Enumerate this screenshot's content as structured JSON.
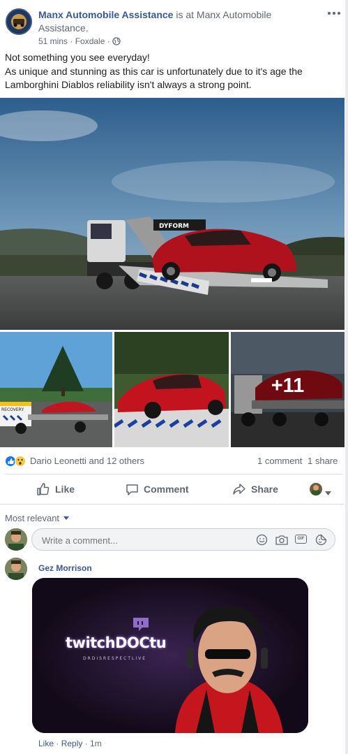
{
  "post": {
    "page_name": "Manx Automobile Assistance",
    "is_at_text": " is at ",
    "location_name": "Manx Automobile Assistance.",
    "time": "51 mins",
    "separator": " · ",
    "place": "Foxdale",
    "separator2": " · ",
    "text_line1": "Not something you see everyday!",
    "text_line2": "As unique and stunning as this car is unfortunately due to it's age the",
    "text_line3": "Lamborghini Diablos reliability isn't always a strong point.",
    "main_truck_brand": "DYFORM",
    "thumb1_truck_label": "RECOVERY",
    "more_photos": "+11"
  },
  "reactions": {
    "names": "Dario Leonetti and 12 others",
    "comments": "1 comment",
    "shares": "1 share"
  },
  "actions": {
    "like": "Like",
    "comment": "Comment",
    "share": "Share"
  },
  "comments_section": {
    "sort": "Most relevant",
    "placeholder": "Write a comment...",
    "gif_label": "GIF"
  },
  "comment": {
    "author": "Gez Morrison",
    "gif_brand": "twitchDOCtu",
    "gif_subtitle": "DRDISRESPECTLIVE",
    "like": "Like",
    "reply": "Reply",
    "time": "1m",
    "sep1": " · ",
    "sep2": " · "
  },
  "colors": {
    "link": "#385898",
    "muted": "#606770",
    "like_blue": "#1877f2",
    "car_red": "#b0121d",
    "twitch_purple": "#6441a4",
    "gif_background": "#1a1020"
  },
  "icons": [
    "more-icon",
    "globe-icon",
    "like-reaction-icon",
    "wow-reaction-icon",
    "thumbs-up-icon",
    "comment-icon",
    "share-icon",
    "chevron-down-icon",
    "smiley-icon",
    "camera-icon",
    "gif-icon",
    "sticker-icon"
  ]
}
